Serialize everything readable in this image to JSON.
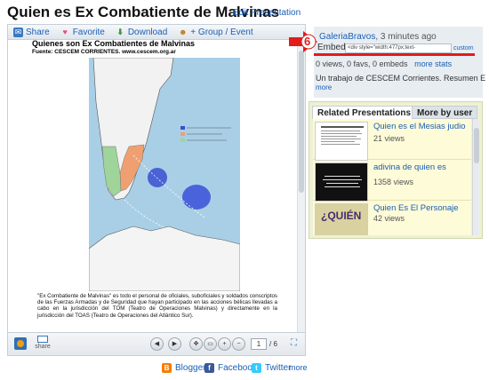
{
  "page": {
    "title": "Quien es Ex Combatiente de Malvinas",
    "edit_link": "Edit Presentation"
  },
  "toolbar": {
    "share": "Share",
    "favorite": "Favorite",
    "download": "Download",
    "group_event": "+ Group / Event"
  },
  "slide": {
    "doc_title": "Quienes son Ex Combatientes de Malvinas",
    "doc_source": "Fuente: CESCEM CORRIENTES. www.cescem.org.ar",
    "body_text": "\"Ex Combatiente de Malvinas\" es todo el personal de oficiales, suboficiales y soldados conscriptos de las Fuerzas Armadas y de Seguridad que hayan participado en las acciones bélicas llevadas a cabo en la jurisdicción del TOM (Teatro de Operaciones Malvinas) y directamente en la jurisdicción del TOAS (Teatro de Operaciones del Atlántico Sur)."
  },
  "viewer_nav": {
    "share_label": "share",
    "current_page": "1",
    "total_pages": "/ 6"
  },
  "share_bar": {
    "blogger": "Blogger",
    "facebook": "Facebook",
    "twitter": "Twitter",
    "more": "more"
  },
  "user": {
    "name": "GaleriaBravos",
    "time": ", 3 minutes ago",
    "embed_label": "Embed",
    "embed_value": "<div style=\"width:477px;text-",
    "embed_custom": "custom",
    "stats": "0 views, 0 favs, 0 embeds",
    "stats_more": "more stats",
    "description": "Un trabajo de CESCEM Corrientes. Resumen E",
    "description_more": "more",
    "annotation_number": "6"
  },
  "related": {
    "tab_active": "Related Presentations",
    "tab_inactive": "More by user",
    "items": [
      {
        "title": "Quien es el Mesias judio",
        "views": "21 views"
      },
      {
        "title": "adivina de quien es",
        "views": "1358 views"
      },
      {
        "title": "Quien Es El Personaje",
        "views": "42 views"
      }
    ],
    "thumb3_text": "¿QUIÉN"
  },
  "colors": {
    "accent_red": "#e21b1b",
    "link_blue": "#1a5fb4",
    "panel_bg": "#e8edf2"
  }
}
